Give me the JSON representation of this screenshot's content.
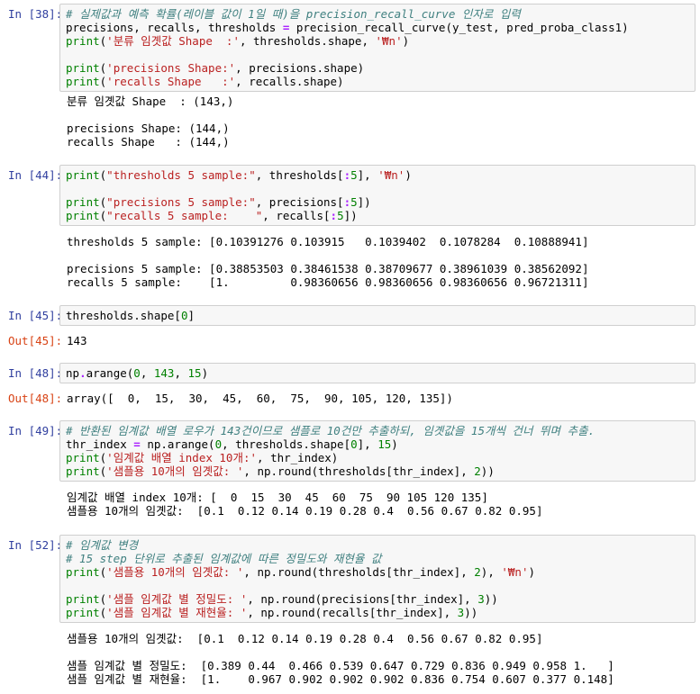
{
  "cells": [
    {
      "prompt": "In [38]:",
      "code": [
        [
          {
            "t": "# 실제값과 예측 확률(레이블 값이 1일 때)을 precision_recall_curve 인자로 입력",
            "c": "comment"
          }
        ],
        [
          {
            "t": "precisions, recalls, thresholds "
          },
          {
            "t": "=",
            "c": "op"
          },
          {
            "t": " precision_recall_curve(y_test, pred_proba_class1)"
          }
        ],
        [
          {
            "t": "print",
            "c": "bi"
          },
          {
            "t": "("
          },
          {
            "t": "'분류 임곗값 Shape  :'",
            "c": "str"
          },
          {
            "t": ", thresholds.shape, "
          },
          {
            "t": "'₩n'",
            "c": "str"
          },
          {
            "t": ")"
          }
        ],
        [],
        [
          {
            "t": "print",
            "c": "bi"
          },
          {
            "t": "("
          },
          {
            "t": "'precisions Shape:'",
            "c": "str"
          },
          {
            "t": ", precisions.shape)"
          }
        ],
        [
          {
            "t": "print",
            "c": "bi"
          },
          {
            "t": "("
          },
          {
            "t": "'recalls Shape   :'",
            "c": "str"
          },
          {
            "t": ", recalls.shape)"
          }
        ]
      ],
      "output": [
        "분류 임곗값 Shape  : (143,)",
        "",
        "precisions Shape: (144,)",
        "recalls Shape   : (144,)"
      ]
    },
    {
      "prompt": "In [44]:",
      "code": [
        [
          {
            "t": "print",
            "c": "bi"
          },
          {
            "t": "("
          },
          {
            "t": "\"thresholds 5 sample:\"",
            "c": "str"
          },
          {
            "t": ", thresholds["
          },
          {
            "t": ":",
            "c": "op"
          },
          {
            "t": "5",
            "c": "num"
          },
          {
            "t": "], "
          },
          {
            "t": "'₩n'",
            "c": "str"
          },
          {
            "t": ")"
          }
        ],
        [],
        [
          {
            "t": "print",
            "c": "bi"
          },
          {
            "t": "("
          },
          {
            "t": "\"precisions 5 sample:\"",
            "c": "str"
          },
          {
            "t": ", precisions["
          },
          {
            "t": ":",
            "c": "op"
          },
          {
            "t": "5",
            "c": "num"
          },
          {
            "t": "])"
          }
        ],
        [
          {
            "t": "print",
            "c": "bi"
          },
          {
            "t": "("
          },
          {
            "t": "\"recalls 5 sample:    \"",
            "c": "str"
          },
          {
            "t": ", recalls["
          },
          {
            "t": ":",
            "c": "op"
          },
          {
            "t": "5",
            "c": "num"
          },
          {
            "t": "])"
          }
        ]
      ],
      "output": [
        "thresholds 5 sample: [0.10391276 0.103915   0.1039402  0.1078284  0.10888941]",
        "",
        "precisions 5 sample: [0.38853503 0.38461538 0.38709677 0.38961039 0.38562092]",
        "recalls 5 sample:    [1.         0.98360656 0.98360656 0.98360656 0.96721311]"
      ]
    },
    {
      "prompt": "In [45]:",
      "code": [
        [
          {
            "t": "thresholds.shape["
          },
          {
            "t": "0",
            "c": "num"
          },
          {
            "t": "]"
          }
        ]
      ],
      "out_prompt": "Out[45]:",
      "output": [
        "143"
      ]
    },
    {
      "prompt": "In [48]:",
      "code": [
        [
          {
            "t": "np"
          },
          {
            "t": ".",
            "c": "op"
          },
          {
            "t": "arange("
          },
          {
            "t": "0",
            "c": "num"
          },
          {
            "t": ", "
          },
          {
            "t": "143",
            "c": "num"
          },
          {
            "t": ", "
          },
          {
            "t": "15",
            "c": "num"
          },
          {
            "t": ")"
          }
        ]
      ],
      "out_prompt": "Out[48]:",
      "output": [
        "array([  0,  15,  30,  45,  60,  75,  90, 105, 120, 135])"
      ]
    },
    {
      "prompt": "In [49]:",
      "code": [
        [
          {
            "t": "# 반환된 임계값 배열 로우가 143건이므로 샘플로 10건만 추출하되, 임곗값을 15개씩 건너 뛰며 추출.",
            "c": "comment"
          }
        ],
        [
          {
            "t": "thr_index "
          },
          {
            "t": "=",
            "c": "op"
          },
          {
            "t": " np.arange("
          },
          {
            "t": "0",
            "c": "num"
          },
          {
            "t": ", thresholds.shape["
          },
          {
            "t": "0",
            "c": "num"
          },
          {
            "t": "], "
          },
          {
            "t": "15",
            "c": "num"
          },
          {
            "t": ")"
          }
        ],
        [
          {
            "t": "print",
            "c": "bi"
          },
          {
            "t": "("
          },
          {
            "t": "'임계값 배열 index 10개:'",
            "c": "str"
          },
          {
            "t": ", thr_index)"
          }
        ],
        [
          {
            "t": "print",
            "c": "bi"
          },
          {
            "t": "("
          },
          {
            "t": "'샘플용 10개의 임곗값: '",
            "c": "str"
          },
          {
            "t": ", np.round(thresholds[thr_index], "
          },
          {
            "t": "2",
            "c": "num"
          },
          {
            "t": "))"
          }
        ]
      ],
      "output": [
        "임계값 배열 index 10개: [  0  15  30  45  60  75  90 105 120 135]",
        "샘플용 10개의 임곗값:  [0.1  0.12 0.14 0.19 0.28 0.4  0.56 0.67 0.82 0.95]"
      ]
    },
    {
      "prompt": "In [52]:",
      "code": [
        [
          {
            "t": "# 임계값 변경",
            "c": "comment"
          }
        ],
        [
          {
            "t": "# 15 step 단위로 추출된 임계값에 따른 정밀도와 재현율 값",
            "c": "comment"
          }
        ],
        [
          {
            "t": "print",
            "c": "bi"
          },
          {
            "t": "("
          },
          {
            "t": "'샘플용 10개의 임곗값: '",
            "c": "str"
          },
          {
            "t": ", np.round(thresholds[thr_index], "
          },
          {
            "t": "2",
            "c": "num"
          },
          {
            "t": "), "
          },
          {
            "t": "'₩n'",
            "c": "str"
          },
          {
            "t": ")"
          }
        ],
        [],
        [
          {
            "t": "print",
            "c": "bi"
          },
          {
            "t": "("
          },
          {
            "t": "'샘플 임계값 별 정밀도: '",
            "c": "str"
          },
          {
            "t": ", np.round(precisions[thr_index], "
          },
          {
            "t": "3",
            "c": "num"
          },
          {
            "t": "))"
          }
        ],
        [
          {
            "t": "print",
            "c": "bi"
          },
          {
            "t": "("
          },
          {
            "t": "'샘플 임계값 별 재현율: '",
            "c": "str"
          },
          {
            "t": ", np.round(recalls[thr_index], "
          },
          {
            "t": "3",
            "c": "num"
          },
          {
            "t": "))"
          }
        ]
      ],
      "output": [
        "샘플용 10개의 임곗값:  [0.1  0.12 0.14 0.19 0.28 0.4  0.56 0.67 0.82 0.95]",
        "",
        "샘플 임계값 별 정밀도:  [0.389 0.44  0.466 0.539 0.647 0.729 0.836 0.949 0.958 1.   ]",
        "샘플 임계값 별 재현율:  [1.    0.967 0.902 0.902 0.902 0.836 0.754 0.607 0.377 0.148]"
      ]
    }
  ]
}
